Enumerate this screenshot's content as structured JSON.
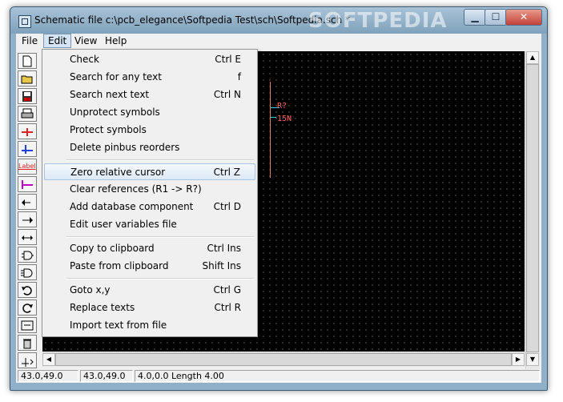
{
  "window": {
    "title": "Schematic file c:\\pcb_elegance\\Softpedia Test\\sch\\Softpedia.sch *",
    "watermark": "SOFTPEDIA"
  },
  "titlebar_buttons": {
    "minimize": "▁",
    "maximize": "☐",
    "close": "✕"
  },
  "menubar": {
    "items": [
      "File",
      "Edit",
      "View",
      "Help"
    ],
    "active": "Edit"
  },
  "edit_menu": {
    "items": [
      {
        "label": "Check",
        "shortcut": "Ctrl E"
      },
      {
        "label": "Search for any text",
        "shortcut": "f"
      },
      {
        "label": "Search next text",
        "shortcut": "Ctrl N"
      },
      {
        "label": "Unprotect symbols",
        "shortcut": ""
      },
      {
        "label": "Protect symbols",
        "shortcut": ""
      },
      {
        "label": "Delete pinbus reorders",
        "shortcut": ""
      },
      {
        "label": "Zero relative cursor",
        "shortcut": "Ctrl Z"
      },
      {
        "label": "Clear references (R1 -> R?)",
        "shortcut": ""
      },
      {
        "label": "Add database component",
        "shortcut": "Ctrl D"
      },
      {
        "label": "Edit user variables file",
        "shortcut": ""
      },
      {
        "label": "Copy to clipboard",
        "shortcut": "Ctrl Ins"
      },
      {
        "label": "Paste from clipboard",
        "shortcut": "Shift Ins"
      },
      {
        "label": "Goto x,y",
        "shortcut": "Ctrl G"
      },
      {
        "label": "Replace texts",
        "shortcut": "Ctrl R"
      },
      {
        "label": "Import text from file",
        "shortcut": ""
      }
    ],
    "highlighted": "Zero relative cursor"
  },
  "toolbar": {
    "tools": [
      "new-file-icon",
      "open-folder-icon",
      "save-disk-icon",
      "print-icon",
      "wire-red-icon",
      "wire-blue-icon",
      "label-icon",
      "bus-entry-icon",
      "left-connector-icon",
      "right-connector-icon",
      "bidirectional-connector-icon",
      "component-icon",
      "component-pins-icon",
      "undo-icon",
      "redo-icon",
      "fit-view-icon",
      "delete-icon",
      "move-icon"
    ],
    "label_tool_text": "Label"
  },
  "canvas": {
    "background": "#000000",
    "labels": [
      "R?",
      "15N"
    ]
  },
  "statusbar": {
    "abs_coords": "43.0,49.0",
    "rel_coords": "43.0,49.0",
    "info": "4.0,0.0  Length 4.00"
  },
  "colors": {
    "highlight_bg": "#dce9f6",
    "highlight_border": "#a8c4e0",
    "titlebar": "#8fb0c8"
  }
}
